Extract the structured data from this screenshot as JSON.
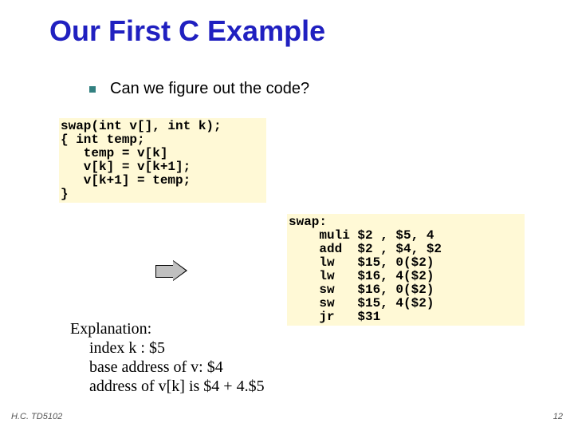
{
  "title": "Our First C Example",
  "bullet": "Can we figure out the code?",
  "c_code": "swap(int v[], int k);\n{ int temp;\n   temp = v[k]\n   v[k] = v[k+1];\n   v[k+1] = temp;\n}",
  "mips_code": "swap:\n    muli $2 , $5, 4\n    add  $2 , $4, $2\n    lw   $15, 0($2)\n    lw   $16, 4($2)\n    sw   $16, 0($2)\n    sw   $15, 4($2)\n    jr   $31",
  "explanation": {
    "heading": "Explanation:",
    "line1": "index k : $5",
    "line2": "base address of v: $4",
    "line3": "address of v[k] is $4 + 4.$5"
  },
  "footer": {
    "left": "H.C. TD5102",
    "right": "12"
  }
}
